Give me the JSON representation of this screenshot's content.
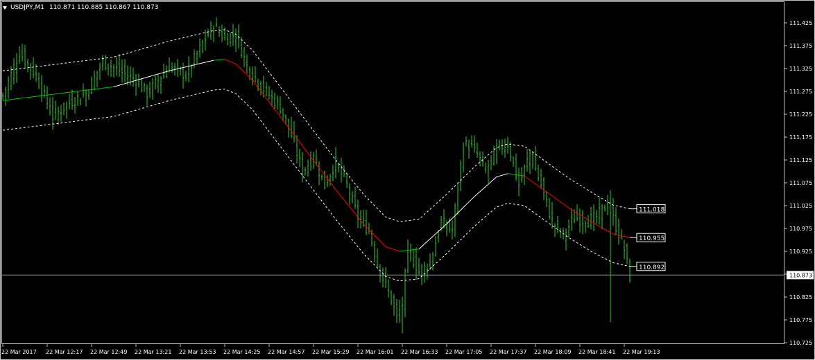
{
  "window": {
    "symbol_timeframe": "USDJPY,M1",
    "quote": "110.871 110.885 110.867 110.873"
  },
  "colors": {
    "background": "#000000",
    "frame": "#c0c0c0",
    "candles": "#32cd32",
    "envelope": "#ffffff",
    "ma_up": "#ffffff",
    "ma_flat": "#00c800",
    "ma_down": "#ff0000",
    "price_line": "#7f9fb3",
    "text": "#ffffff"
  },
  "chart_data": {
    "type": "line",
    "title": "USDJPY,M1",
    "y_axis": {
      "range": [
        110.71,
        111.47
      ],
      "ticks": [
        "111.425",
        "111.375",
        "111.325",
        "111.275",
        "111.225",
        "111.175",
        "111.125",
        "111.075",
        "111.025",
        "110.975",
        "110.925",
        "110.875",
        "110.825",
        "110.775",
        "110.725"
      ]
    },
    "x_axis": {
      "ticks": [
        "22 Mar 2017",
        "22 Mar 12:17",
        "22 Mar 12:49",
        "22 Mar 13:21",
        "22 Mar 13:53",
        "22 Mar 14:25",
        "22 Mar 14:57",
        "22 Mar 15:29",
        "22 Mar 16:01",
        "22 Mar 16:33",
        "22 Mar 17:05",
        "22 Mar 17:37",
        "22 Mar 18:09",
        "22 Mar 18:41",
        "22 Mar 19:13"
      ]
    },
    "price_anchors": [
      [
        0,
        111.265
      ],
      [
        6,
        111.36
      ],
      [
        12,
        111.31
      ],
      [
        18,
        111.22
      ],
      [
        24,
        111.25
      ],
      [
        30,
        111.27
      ],
      [
        36,
        111.34
      ],
      [
        42,
        111.32
      ],
      [
        48,
        111.3
      ],
      [
        52,
        111.27
      ],
      [
        56,
        111.3
      ],
      [
        60,
        111.33
      ],
      [
        66,
        111.31
      ],
      [
        72,
        111.38
      ],
      [
        76,
        111.42
      ],
      [
        80,
        111.39
      ],
      [
        84,
        111.4
      ],
      [
        88,
        111.33
      ],
      [
        94,
        111.28
      ],
      [
        100,
        111.24
      ],
      [
        104,
        111.18
      ],
      [
        108,
        111.1
      ],
      [
        112,
        111.13
      ],
      [
        116,
        111.07
      ],
      [
        120,
        111.12
      ],
      [
        124,
        111.07
      ],
      [
        128,
        111.0
      ],
      [
        132,
        110.97
      ],
      [
        135,
        110.9
      ],
      [
        138,
        110.85
      ],
      [
        140,
        110.82
      ],
      [
        142,
        110.78
      ],
      [
        144,
        110.81
      ],
      [
        146,
        110.93
      ],
      [
        150,
        110.88
      ],
      [
        154,
        110.9
      ],
      [
        158,
        110.99
      ],
      [
        162,
        110.97
      ],
      [
        166,
        111.16
      ],
      [
        170,
        111.15
      ],
      [
        174,
        111.1
      ],
      [
        178,
        111.15
      ],
      [
        182,
        111.16
      ],
      [
        186,
        111.07
      ],
      [
        190,
        111.14
      ],
      [
        194,
        111.07
      ],
      [
        198,
        110.99
      ],
      [
        202,
        110.96
      ],
      [
        206,
        111.0
      ],
      [
        210,
        110.99
      ],
      [
        214,
        111.0
      ],
      [
        218,
        111.03
      ],
      [
        221,
        110.98
      ],
      [
        224,
        110.93
      ],
      [
        226,
        110.87
      ]
    ],
    "series": [
      {
        "values": [
          [
            0,
            111.255
          ],
          [
            20,
            111.27
          ],
          [
            40,
            111.285
          ],
          [
            60,
            111.32
          ],
          [
            76,
            111.343
          ],
          [
            80,
            111.345
          ],
          [
            84,
            111.335
          ],
          [
            90,
            111.3
          ],
          [
            100,
            111.22
          ],
          [
            110,
            111.14
          ],
          [
            120,
            111.06
          ],
          [
            130,
            110.985
          ],
          [
            138,
            110.935
          ],
          [
            143,
            110.925
          ],
          [
            150,
            110.93
          ],
          [
            160,
            110.985
          ],
          [
            170,
            111.045
          ],
          [
            178,
            111.088
          ],
          [
            182,
            111.095
          ],
          [
            188,
            111.09
          ],
          [
            196,
            111.055
          ],
          [
            204,
            111.02
          ],
          [
            212,
            110.99
          ],
          [
            220,
            110.963
          ],
          [
            226,
            110.955
          ]
        ]
      },
      {
        "values": [
          [
            0,
            111.32
          ],
          [
            20,
            111.335
          ],
          [
            40,
            111.35
          ],
          [
            60,
            111.385
          ],
          [
            76,
            111.408
          ],
          [
            80,
            111.41
          ],
          [
            84,
            111.4
          ],
          [
            90,
            111.365
          ],
          [
            100,
            111.285
          ],
          [
            110,
            111.205
          ],
          [
            120,
            111.125
          ],
          [
            130,
            111.05
          ],
          [
            138,
            111.0
          ],
          [
            143,
            110.99
          ],
          [
            150,
            110.995
          ],
          [
            160,
            111.05
          ],
          [
            170,
            111.11
          ],
          [
            178,
            111.152
          ],
          [
            182,
            111.16
          ],
          [
            188,
            111.155
          ],
          [
            196,
            111.12
          ],
          [
            204,
            111.085
          ],
          [
            212,
            111.055
          ],
          [
            220,
            111.026
          ],
          [
            226,
            111.018
          ]
        ]
      },
      {
        "values": [
          [
            0,
            111.19
          ],
          [
            20,
            111.205
          ],
          [
            40,
            111.22
          ],
          [
            60,
            111.255
          ],
          [
            76,
            111.278
          ],
          [
            80,
            111.28
          ],
          [
            84,
            111.27
          ],
          [
            90,
            111.235
          ],
          [
            100,
            111.155
          ],
          [
            110,
            111.075
          ],
          [
            120,
            110.995
          ],
          [
            130,
            110.92
          ],
          [
            138,
            110.87
          ],
          [
            143,
            110.86
          ],
          [
            150,
            110.865
          ],
          [
            160,
            110.92
          ],
          [
            170,
            110.98
          ],
          [
            178,
            111.022
          ],
          [
            182,
            111.03
          ],
          [
            188,
            111.025
          ],
          [
            196,
            110.99
          ],
          [
            204,
            110.955
          ],
          [
            212,
            110.925
          ],
          [
            220,
            110.9
          ],
          [
            226,
            110.892
          ]
        ]
      }
    ],
    "current_price": "110.873",
    "tags": [
      {
        "value": "111.018",
        "y": 111.018
      },
      {
        "value": "110.955",
        "y": 110.955
      },
      {
        "value": "110.892",
        "y": 110.892
      }
    ],
    "grid": false
  }
}
